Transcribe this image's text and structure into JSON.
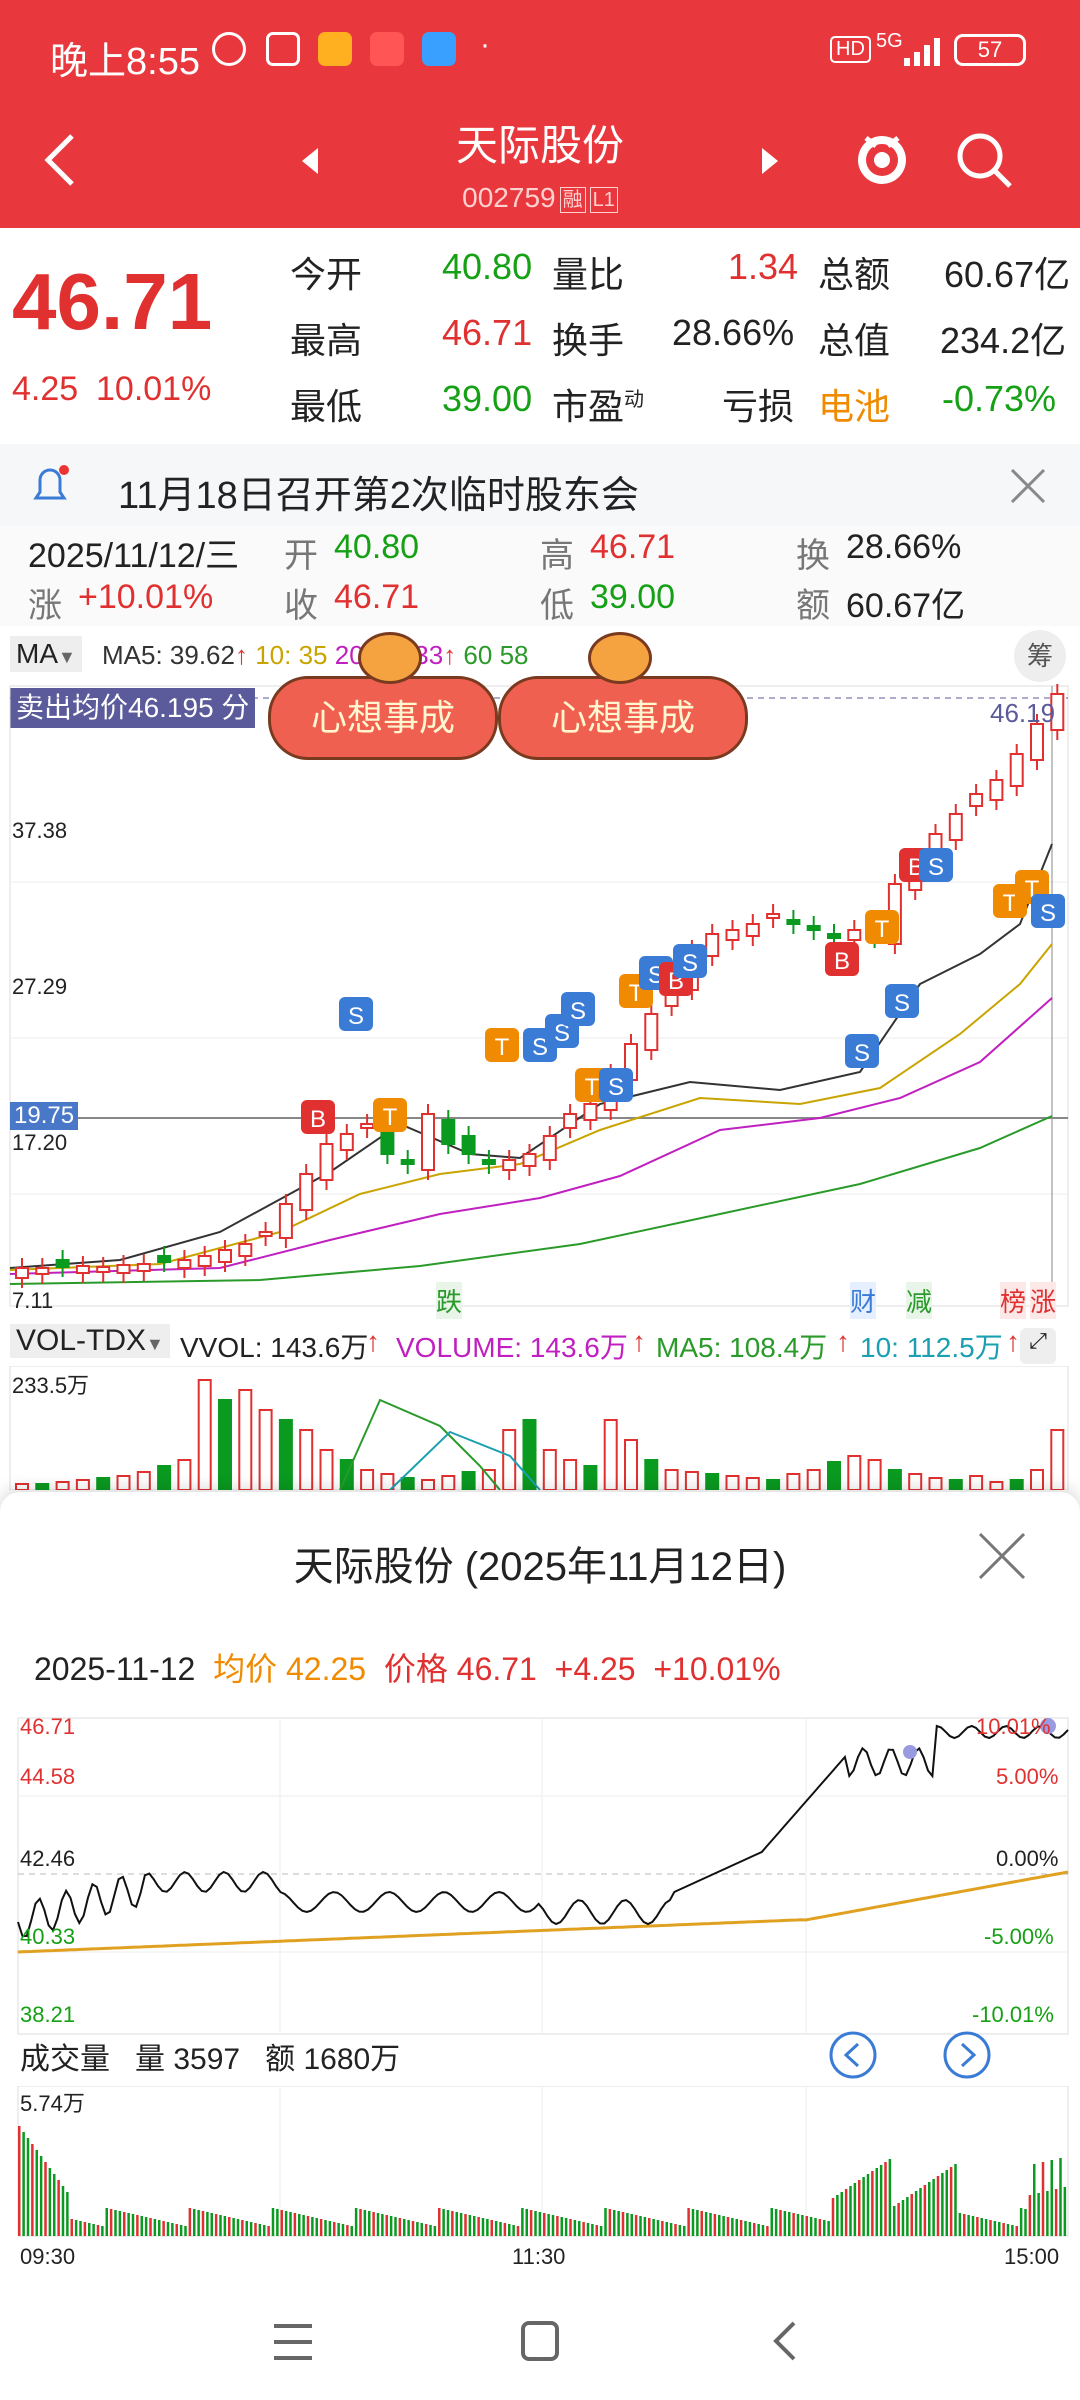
{
  "status_bar": {
    "time": "晚上8:55",
    "network": "5G",
    "battery": "57",
    "hd": "HD"
  },
  "header": {
    "title": "天际股份",
    "code": "002759",
    "tags": [
      "融",
      "L1"
    ]
  },
  "quote": {
    "price": "46.71",
    "change": "4.25",
    "change_pct": "10.01%",
    "rows": [
      [
        {
          "label": "今开",
          "value": "40.80",
          "color": "green"
        },
        {
          "label": "量比",
          "value": "1.34",
          "color": "red"
        },
        {
          "label": "总额",
          "value": "60.67亿",
          "color": "dark"
        }
      ],
      [
        {
          "label": "最高",
          "value": "46.71",
          "color": "red"
        },
        {
          "label": "换手",
          "value": "28.66%",
          "color": "dark"
        },
        {
          "label": "总值",
          "value": "234.2亿",
          "color": "dark"
        }
      ],
      [
        {
          "label": "最低",
          "value": "39.00",
          "color": "green"
        },
        {
          "label": "市盈",
          "value": "亏损",
          "color": "dark"
        },
        {
          "label": "电池",
          "value": "-0.73%",
          "color": "green"
        }
      ]
    ],
    "pe_sup": "动"
  },
  "notice": {
    "text": "11月18日召开第2次临时股东会"
  },
  "ohlc": {
    "date": "2025/11/12/三",
    "open_label": "开",
    "open": "40.80",
    "high_label": "高",
    "high": "46.71",
    "turn_label": "换",
    "turn": "28.66%",
    "chg_label": "涨",
    "chg": "+10.01%",
    "close_label": "收",
    "close": "46.71",
    "low_label": "低",
    "low": "39.00",
    "amt_label": "额",
    "amt": "60.67亿"
  },
  "ma_legend": {
    "mode": "MA",
    "ma5": "MA5: 39.62",
    "ma10": "10: 35",
    "ma20": "20: 29.33",
    "ma60": "60",
    "ma60b": "58",
    "chip": "筹"
  },
  "kline": {
    "sell_avg": "卖出均价46.195 分",
    "price_labels": [
      "37.38",
      "27.29",
      "19.75",
      "17.20",
      "7.11"
    ],
    "last_label": "46.19",
    "banner": "心想事成",
    "markers_bottom": [
      "跌",
      "财",
      "减",
      "榜",
      "涨"
    ]
  },
  "volume_legend": {
    "mode": "VOL-TDX",
    "vvol": "VVOL: 143.6万",
    "volume": "VOLUME: 143.6万",
    "ma5": "MA5: 108.4万",
    "ma10": "10: 112.5万",
    "max": "233.5万"
  },
  "intraday": {
    "title": "天际股份 (2025年11月12日)",
    "date": "2025-11-12",
    "avg_label": "均价",
    "avg": "42.25",
    "price_label": "价格",
    "price": "46.71",
    "chg": "+4.25",
    "chg_pct": "+10.01%",
    "y_left": [
      "46.71",
      "44.58",
      "42.46",
      "40.33",
      "38.21"
    ],
    "y_right": [
      "10.01%",
      "5.00%",
      "0.00%",
      "-5.00%",
      "-10.01%"
    ],
    "vol_title": "成交量",
    "vol_qty": "量 3597",
    "vol_amt": "额 1680万",
    "vol_max": "5.74万",
    "times": [
      "09:30",
      "11:30",
      "15:00"
    ]
  }
}
